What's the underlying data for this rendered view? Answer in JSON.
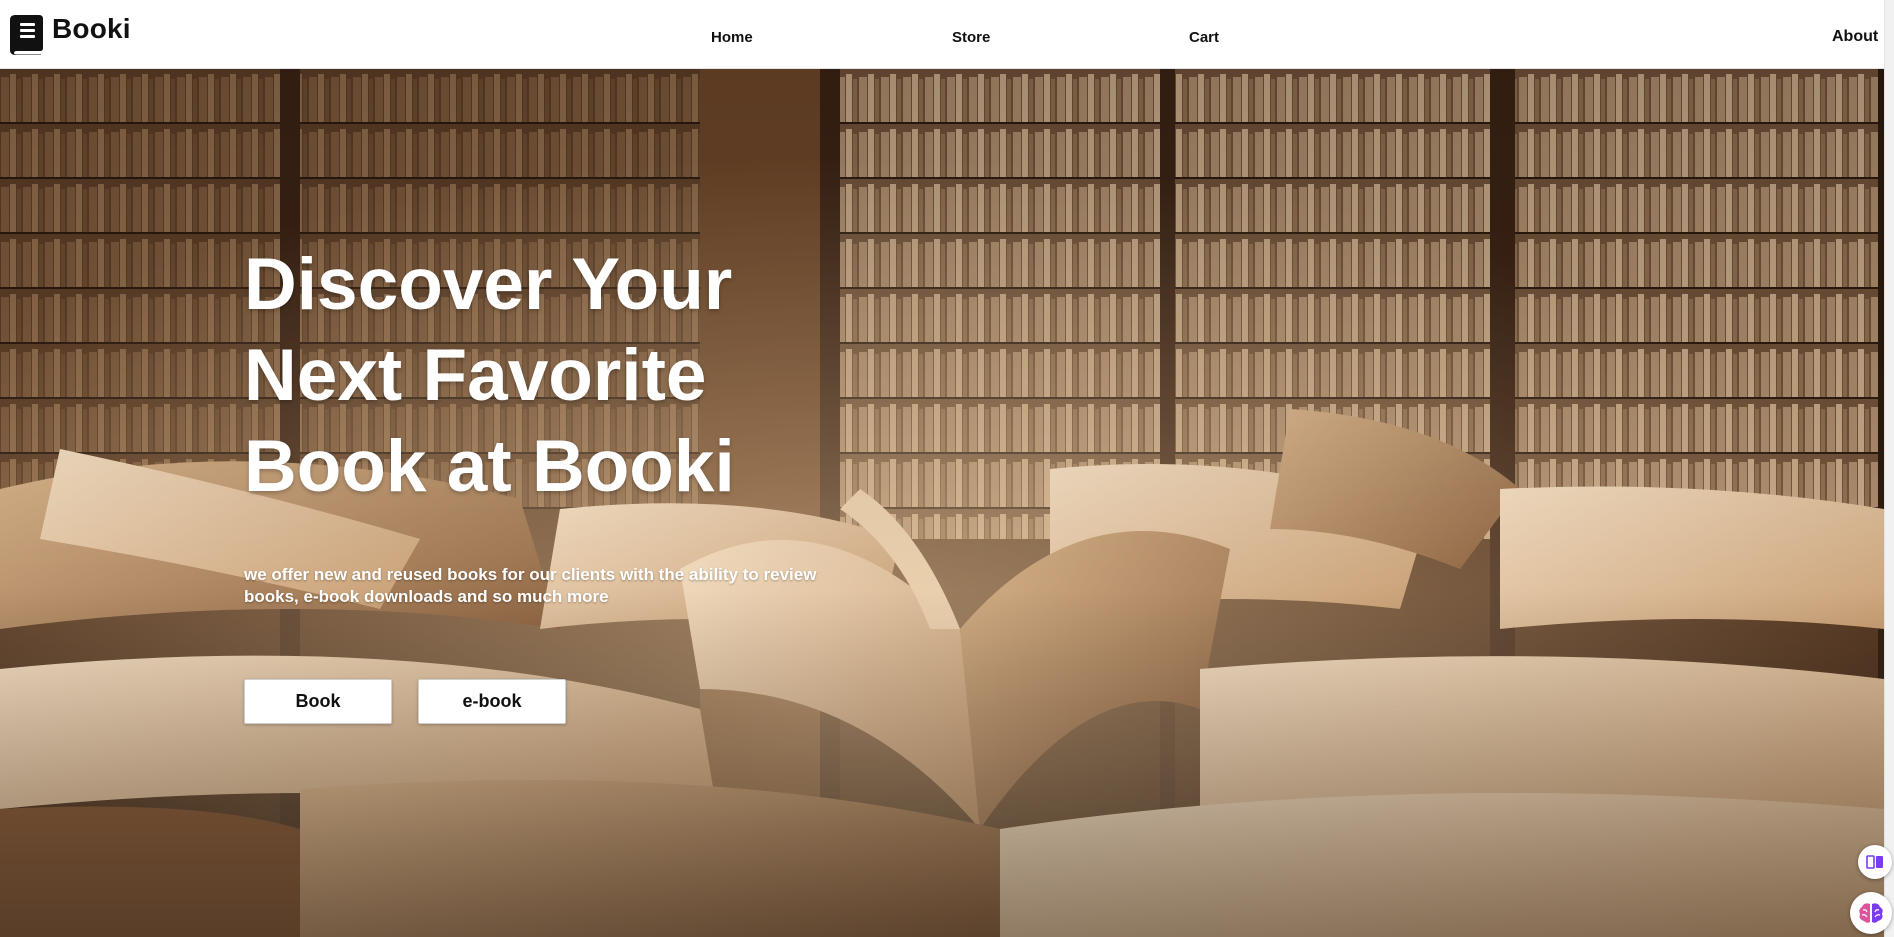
{
  "brand": {
    "name": "Booki",
    "icon": "book-icon",
    "icon_color": "#111111"
  },
  "nav": {
    "links": [
      {
        "label": "Home"
      },
      {
        "label": "Store"
      },
      {
        "label": "Cart"
      },
      {
        "label": "About"
      }
    ]
  },
  "hero": {
    "background": "library-shelves-open-books-image",
    "title_lines": [
      "Discover Your",
      "Next Favorite",
      "Book at Booki"
    ],
    "subtitle": "we offer new and reused books for our clients with the ability to review books, e-book downloads and so much more",
    "buttons": [
      {
        "label": "Book"
      },
      {
        "label": "e-book"
      }
    ]
  },
  "widgets": {
    "reader_icon": "book-reader-icon",
    "brain_icon": "brain-icon",
    "accent": "#7a3cf0"
  },
  "colors": {
    "header_bg": "#ffffff",
    "text_dark": "#111111",
    "hero_text": "#ffffff",
    "button_bg": "#ffffff"
  }
}
